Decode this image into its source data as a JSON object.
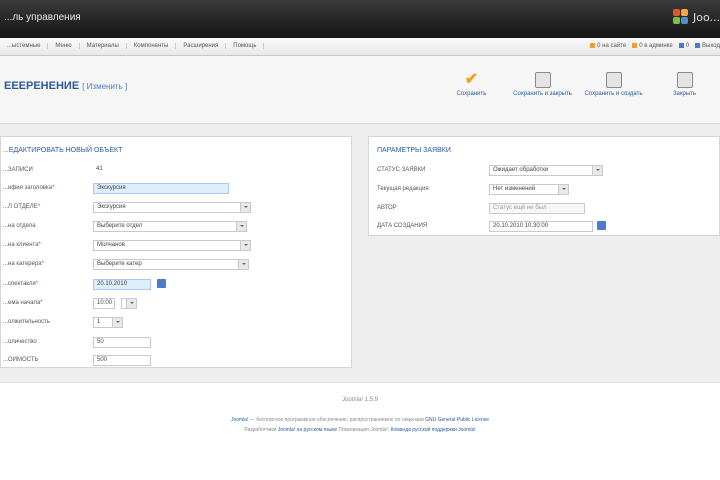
{
  "window": {
    "app_title": "...ль управления",
    "logo_text": "Joo..."
  },
  "menu": {
    "items": [
      "...ыстемные",
      "Меню",
      "Материалы",
      "Компоненты",
      "Расширения",
      "Помощь"
    ],
    "status": [
      "0 на сайте",
      "0 в админке",
      "0",
      "Выход"
    ]
  },
  "page": {
    "title": "ЕЕЕРЕНЕНИЕ",
    "subtitle": "[ Изменить ]"
  },
  "toolbar": {
    "save": "Сохранить",
    "save_close": "Сохранить и закрыть",
    "save_new": "Сохранить и создать",
    "close": "Закрыть"
  },
  "left_panel": {
    "legend": "...ЕДАКТИРОВАТЬ НОВЫЙ ОБЪЕКТ",
    "fields": [
      {
        "label": "...ЗАПИСИ",
        "required": false,
        "value": "41",
        "kind": "readonly"
      },
      {
        "label": "...ифия заголовка",
        "required": true,
        "value": "Экскурсия",
        "kind": "highlight"
      },
      {
        "label": "...Л ОТДЕЛЕ",
        "required": true,
        "value": "Экскурсия",
        "kind": "select"
      },
      {
        "label": "...на отдела",
        "required": false,
        "value": "Выберите отдел",
        "kind": "select"
      },
      {
        "label": "...на клиента",
        "required": true,
        "value": "Молчанов",
        "kind": "select"
      },
      {
        "label": "...на катерера",
        "required": true,
        "value": "Выберите катер",
        "kind": "select"
      },
      {
        "label": "...спектакля",
        "required": true,
        "value": "20.10.2010",
        "kind": "date"
      },
      {
        "label": "...ема начала",
        "required": true,
        "value": "10:00",
        "kind": "time"
      },
      {
        "label": "...олжительность",
        "required": false,
        "value": "1",
        "kind": "select-short"
      },
      {
        "label": "...оличество",
        "required": false,
        "value": "50",
        "kind": "text"
      },
      {
        "label": "...ОИМОСТЬ",
        "required": false,
        "value": "500",
        "kind": "text"
      }
    ]
  },
  "right_panel": {
    "legend": "ПАРАМЕТРЫ ЗАЯВКИ",
    "fields": [
      {
        "label": "СТАТУС ЗАЯВКИ",
        "value": "Ожидает обработки",
        "kind": "select"
      },
      {
        "label": "Текущая редакция",
        "value": "Нет изменений",
        "kind": "spinner"
      },
      {
        "label": "АВТОР",
        "value": "Статус ещё не был",
        "kind": "disabled"
      },
      {
        "label": "ДАТА СОЗДАНИЯ",
        "value": "20.10.2010 10:30:00",
        "kind": "date"
      }
    ]
  },
  "footer": {
    "version": "Joomla! 1.5.9",
    "line1_link": "Joomla!",
    "line1_text": " — бесплатное программное обеспечение, распространяемое по лицензии ",
    "line1_license": "GNU General Public License",
    "line2_prefix": "Разработчики ",
    "line2_link1": "Joomla! на русском языке",
    "line2_mid": " Локализация Joomla!: ",
    "line2_link2": "Команда русской поддержки Joomla!"
  },
  "colors": {
    "accent_blue": "#2a5a9c",
    "check_orange": "#f0a020",
    "topbar_dark": "#1f1f1f",
    "field_highlight": "#dfeefc"
  },
  "icons": [
    "save-check-icon",
    "save-close-icon",
    "save-new-icon",
    "close-icon",
    "calendar-icon",
    "joomla-logo"
  ]
}
